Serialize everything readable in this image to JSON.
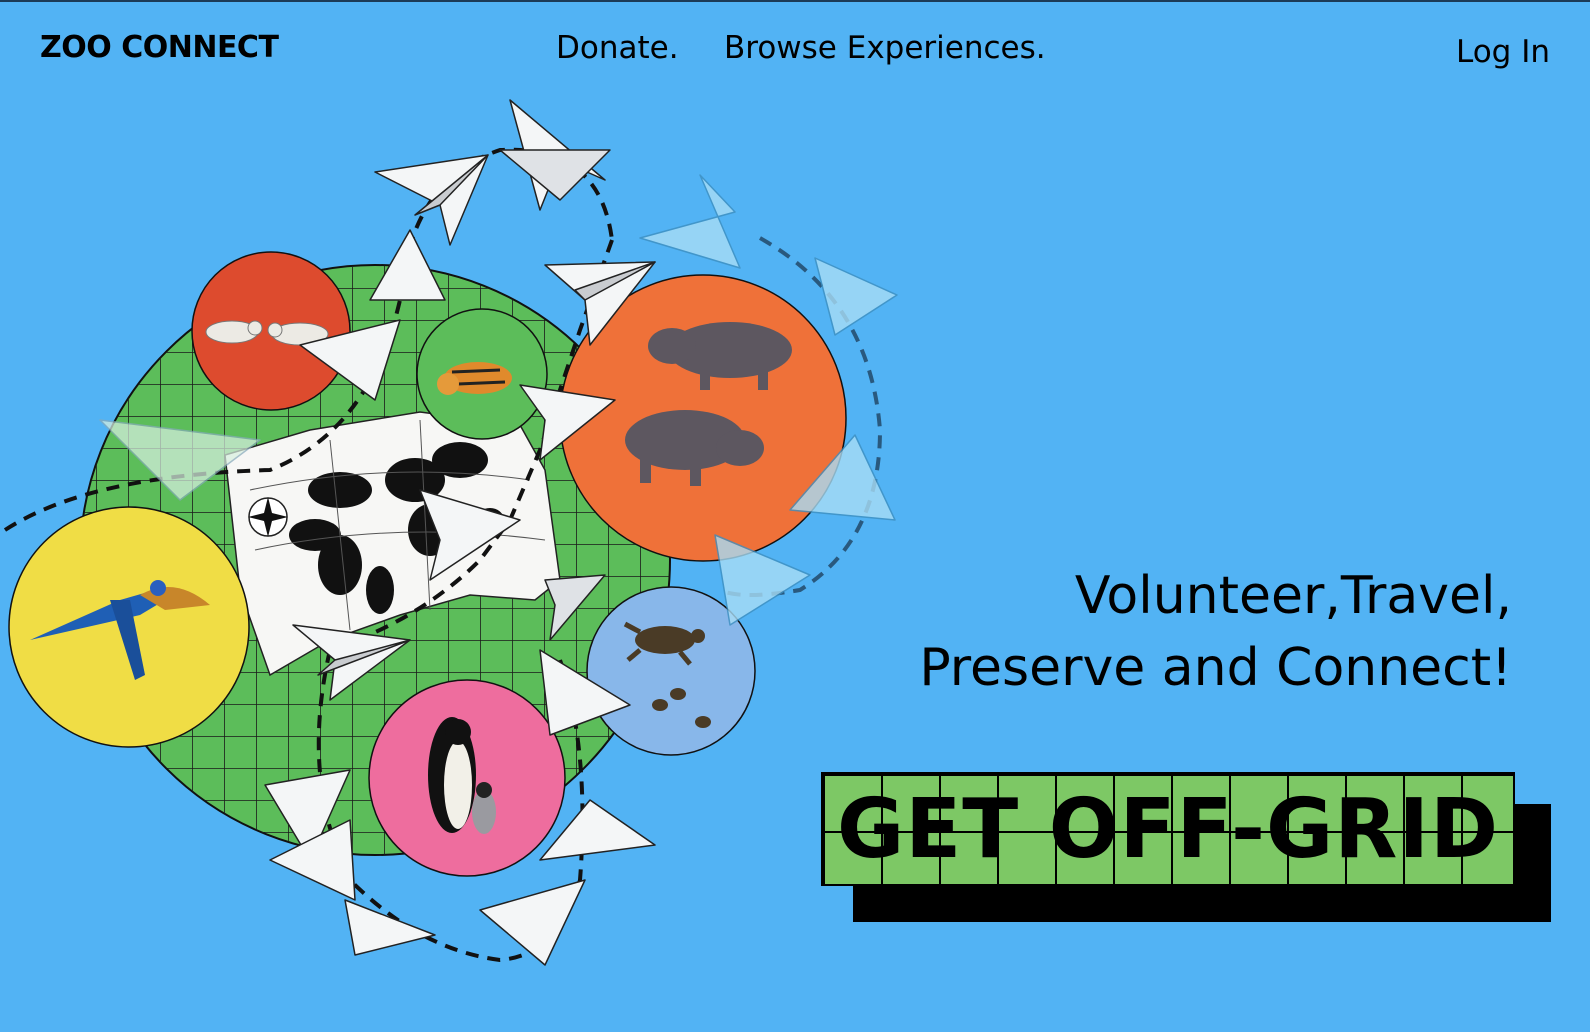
{
  "brand": {
    "name": "ZOO CONNECT"
  },
  "nav": {
    "donate": "Donate.",
    "browse": "Browse Experiences.",
    "login": "Log In"
  },
  "hero": {
    "line1": "Volunteer,Travel,",
    "line2": "Preserve and Connect!",
    "cta_label": "GET OFF-GRID"
  },
  "colors": {
    "background": "#52b3f4",
    "globe_green": "#5cbd5a",
    "cta_green": "#7dc865",
    "polar_bear_circle": "#dd4b2e",
    "tiger_circle": "#5cbd5a",
    "hippo_circle": "#ef7139",
    "macaw_circle": "#f0dd45",
    "penguin_circle": "#ee6d9e",
    "turtle_circle": "#88b7ea"
  },
  "illustration": {
    "animals": [
      "polar-bears",
      "tiger",
      "hippos",
      "macaw",
      "penguins",
      "sea-turtles"
    ],
    "elements": [
      "world-map",
      "compass-rose",
      "paper-planes",
      "dashed-flight-path"
    ]
  }
}
